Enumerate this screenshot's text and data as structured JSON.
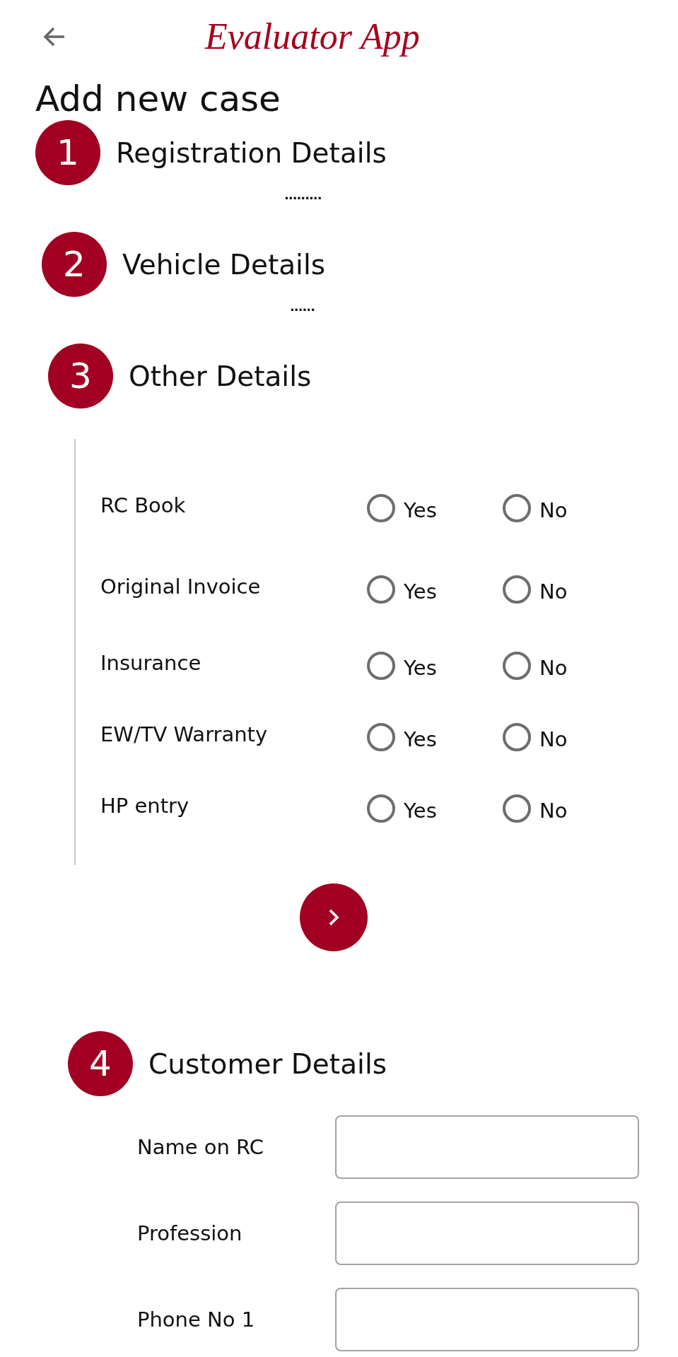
{
  "header": {
    "app_title": "Evaluator App"
  },
  "page_title": "Add new case",
  "steps": [
    {
      "number": "1",
      "title": "Registration Details",
      "connector": "........."
    },
    {
      "number": "2",
      "title": "Vehicle Details",
      "connector": "......"
    },
    {
      "number": "3",
      "title": "Other Details"
    }
  ],
  "other_details": {
    "rows": [
      {
        "label": "RC Book",
        "options": [
          {
            "label": "Yes",
            "selected": false
          },
          {
            "label": "No",
            "selected": false
          }
        ]
      },
      {
        "label": "Original Invoice",
        "options": [
          {
            "label": "Yes",
            "selected": false
          },
          {
            "label": "No",
            "selected": false
          }
        ]
      },
      {
        "label": "Insurance",
        "options": [
          {
            "label": "Yes",
            "selected": false
          },
          {
            "label": "No",
            "selected": false
          }
        ]
      },
      {
        "label": "EW/TV Warranty",
        "options": [
          {
            "label": "Yes",
            "selected": false
          },
          {
            "label": "No",
            "selected": false
          }
        ]
      },
      {
        "label": "HP entry",
        "options": [
          {
            "label": "Yes",
            "selected": false
          },
          {
            "label": "No",
            "selected": false
          }
        ]
      }
    ]
  },
  "customer_step": {
    "number": "4",
    "title": "Customer Details"
  },
  "customer_fields": [
    {
      "label": "Name on RC"
    },
    {
      "label": "Profession"
    },
    {
      "label": "Phone No 1"
    }
  ]
}
